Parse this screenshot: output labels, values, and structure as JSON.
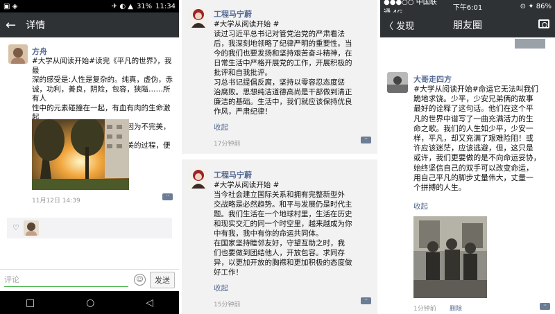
{
  "panel1": {
    "status": {
      "left_icons": "▣ ◈",
      "right_icons": "✈ ◐ ▲",
      "battery": "31%",
      "time": "11:34"
    },
    "nav": {
      "back_icon": "←",
      "title": "详情"
    },
    "post": {
      "author": "方舟",
      "lines": [
        "#大学从阅读开始#读完《平凡的世界》，我最",
        "深的感受是:人性是复杂的。纯真，虚伪，赤",
        "诚，功利，善良，阴险，包容，狭隘……所有人",
        "性中的元素碰撞在一起，有血有肉的生命激起",
        "的火花，是响彻灵魂的交响。因为不完美，所",
        "以真实、丰厚，而努力变得完美的过程，便是",
        "在艰辛的生活里奋斗着的意义。"
      ],
      "time": "11月12日 14:39",
      "more_icon": "··"
    },
    "like_icon": "♡",
    "comment": {
      "placeholder": "评论",
      "emoji_icon": "☺",
      "send": "发送"
    },
    "bottom_nav": {
      "square": "□",
      "circle": "○",
      "triangle": "◁"
    }
  },
  "panel2": {
    "post1": {
      "author": "工程马宁蔚",
      "lines": [
        "#大学从阅读开始 #",
        "    读过习近平总书记对管党治党的严肃看法",
        "后，我深刻地领略了纪律严明的重要性。当",
        "今的我们也要发扬和坚持艰苦奋斗精神，在",
        "日常生活中严格开展党的工作，开展积极的",
        "批评和自我批评。",
        "    习总书记提倡反腐，坚持以零容忍态度惩",
        "治腐败。思想纯洁道德高尚是干部做到清正",
        "廉洁的基础。生活中，我们就应该保持优良",
        "作风，严肃纪律！"
      ],
      "fold": "收起",
      "time": "17分钟前",
      "more_icon": "··"
    },
    "post2": {
      "author": "工程马宁蔚",
      "lines": [
        "#大学从阅读开始 #",
        "    当今社会建立国际关系和拥有完整新型外",
        "交战略是必然趋势。和平与发展仍是时代主",
        "题。我们生活在一个地球村里，生活在历史",
        "和现实交汇的同一个时空里，越来越成为你",
        "中有我，我中有你的命运共同体。",
        "    在国家坚持睦邻友好，守望互助之时，我",
        "们也要做到团结他人，开放包容。求同存",
        "异，以更加开放的胸襟和更加积极的态度做",
        "好工作！"
      ],
      "fold": "收起",
      "time": "15分钟前",
      "more_icon": "··"
    }
  },
  "panel3": {
    "status": {
      "carrier": "●●●○○ 中国联通  4G",
      "time": "下午6:01",
      "battery": "⊙ ✦ 86%"
    },
    "nav": {
      "back": "〈 发现",
      "title": "朋友圈"
    },
    "post": {
      "author": "大哥走四方",
      "lines": [
        "#大学从阅读开始#命运它无法叫我们",
        "跪地求饶。少平，少安兄弟俩的故事",
        "最好的诠释了这句话。他们在这个平",
        "凡的世界中谱写了一曲充满活力的生",
        "命之歌。我们的人生如少平，少安一",
        "样，平凡，却又充满了艰难险阻！或",
        "许应该迷茫，应该逃避，但，这只是",
        "或许，我们更要做的是不向命运妥协，",
        "始终坚信自己的双手可以改变命运，",
        "用自己平凡的脚步丈量伟大，丈量一",
        "个拼搏的人生。"
      ],
      "fold": "收起",
      "time": "1分钟前",
      "delete": "删除",
      "more_icon": "··"
    }
  }
}
